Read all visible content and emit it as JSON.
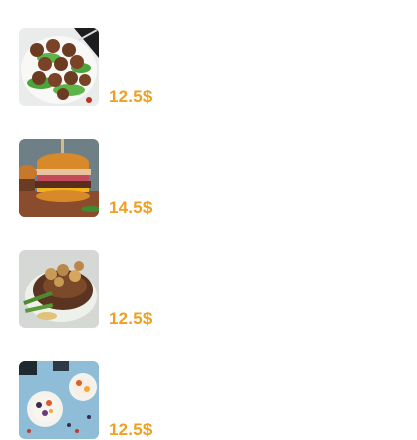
{
  "menu": {
    "items": [
      {
        "image_icon": "meatballs-photo",
        "title": "",
        "price": "12.5$"
      },
      {
        "image_icon": "burger-photo",
        "title": "",
        "price": "14.5$"
      },
      {
        "image_icon": "steak-photo",
        "title": "",
        "price": "12.5$"
      },
      {
        "image_icon": "yogurt-bowl-photo",
        "title": "",
        "price": "12.5$"
      }
    ],
    "price_color": "#f0a01e"
  }
}
